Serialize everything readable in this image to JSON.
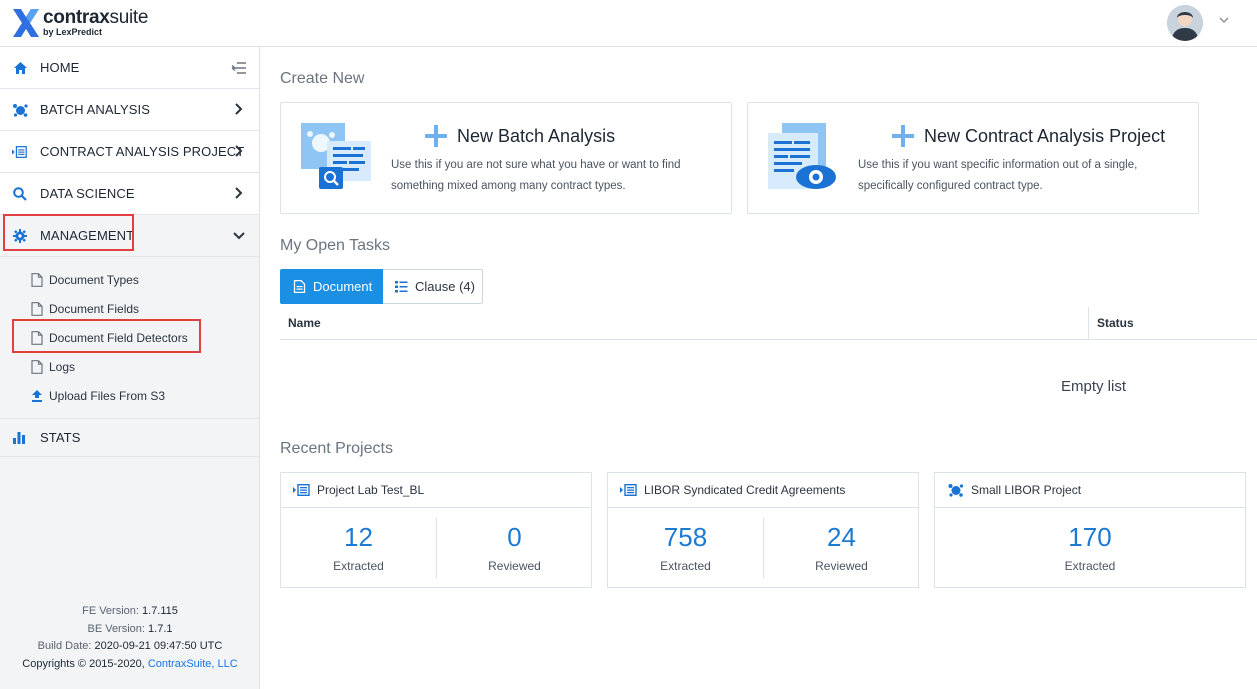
{
  "brand": {
    "name_bold": "contrax",
    "name_light": "suite",
    "tagline": "by LexPredict"
  },
  "user": {
    "avatar_icon": "avatar-icon",
    "menu_icon": "chevron-down-icon"
  },
  "sidebar": {
    "items": [
      {
        "label": "HOME",
        "icon": "home-icon"
      },
      {
        "label": "BATCH ANALYSIS",
        "icon": "batch-icon"
      },
      {
        "label": "CONTRACT ANALYSIS PROJECT",
        "icon": "contract-project-icon"
      },
      {
        "label": "DATA SCIENCE",
        "icon": "search-icon"
      },
      {
        "label": "MANAGEMENT",
        "icon": "gear-icon"
      }
    ],
    "management_sub": [
      {
        "label": "Document Types",
        "icon": "document-icon"
      },
      {
        "label": "Document Fields",
        "icon": "document-icon"
      },
      {
        "label": "Document Field Detectors",
        "icon": "document-icon"
      },
      {
        "label": "Logs",
        "icon": "document-icon"
      },
      {
        "label": "Upload Files From S3",
        "icon": "upload-icon"
      }
    ],
    "stats": {
      "label": "STATS",
      "icon": "bar-chart-icon"
    },
    "version": {
      "fe_label": "FE Version:",
      "fe_value": "1.7.115",
      "be_label": "BE Version:",
      "be_value": "1.7.1",
      "build_label": "Build Date:",
      "build_value": "2020-09-21 09:47:50 UTC",
      "copyright": "Copyrights © 2015-2020,",
      "company": "ContraxSuite, LLC"
    }
  },
  "main": {
    "create_new_title": "Create New",
    "create_cards": [
      {
        "title": "New Batch Analysis",
        "desc": "Use this if you are not sure what you have or want to find something mixed among many contract types."
      },
      {
        "title": "New Contract Analysis Project",
        "desc": "Use this if you want specific information out of a single, specifically configured contract type."
      }
    ],
    "open_tasks_title": "My Open Tasks",
    "tabs": [
      {
        "label": "Document",
        "active": true
      },
      {
        "label": "Clause (4)",
        "active": false
      }
    ],
    "table": {
      "col_name": "Name",
      "col_status": "Status",
      "empty": "Empty list"
    },
    "recent_title": "Recent Projects",
    "projects": [
      {
        "name": "Project Lab Test_BL",
        "type_icon": "contract-project-icon",
        "extracted": "12",
        "extracted_label": "Extracted",
        "reviewed": "0",
        "reviewed_label": "Reviewed"
      },
      {
        "name": "LIBOR Syndicated Credit Agreements",
        "type_icon": "contract-project-icon",
        "extracted": "758",
        "extracted_label": "Extracted",
        "reviewed": "24",
        "reviewed_label": "Reviewed"
      },
      {
        "name": "Small LIBOR Project",
        "type_icon": "batch-icon",
        "extracted": "170",
        "extracted_label": "Extracted"
      }
    ]
  },
  "colors": {
    "accent": "#1a8fe3",
    "highlight": "#e0413f",
    "metric": "#1a7ad4"
  }
}
